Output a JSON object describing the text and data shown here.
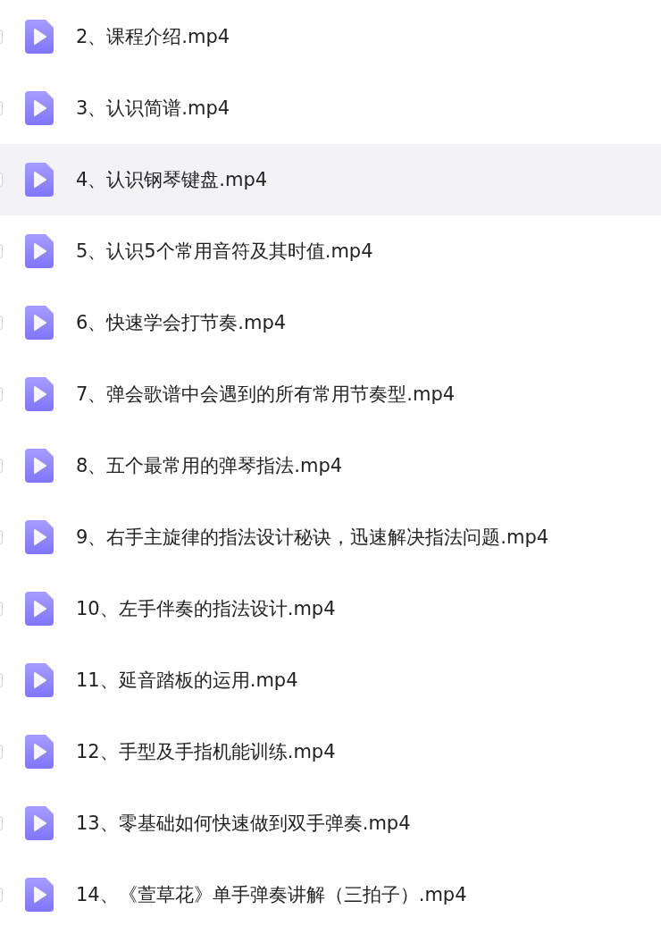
{
  "files": [
    {
      "name": "2、课程介绍.mp4",
      "checked": false,
      "selected": false
    },
    {
      "name": "3、认识简谱.mp4",
      "checked": false,
      "selected": false
    },
    {
      "name": "4、认识钢琴键盘.mp4",
      "checked": false,
      "selected": true
    },
    {
      "name": "5、认识5个常用音符及其时值.mp4",
      "checked": false,
      "selected": false
    },
    {
      "name": "6、快速学会打节奏.mp4",
      "checked": false,
      "selected": false
    },
    {
      "name": "7、弹会歌谱中会遇到的所有常用节奏型.mp4",
      "checked": false,
      "selected": false
    },
    {
      "name": "8、五个最常用的弹琴指法.mp4",
      "checked": false,
      "selected": false
    },
    {
      "name": "9、右手主旋律的指法设计秘诀，迅速解决指法问题.mp4",
      "checked": false,
      "selected": false
    },
    {
      "name": "10、左手伴奏的指法设计.mp4",
      "checked": false,
      "selected": false
    },
    {
      "name": "11、延音踏板的运用.mp4",
      "checked": false,
      "selected": false
    },
    {
      "name": "12、手型及手指机能训练.mp4",
      "checked": false,
      "selected": false
    },
    {
      "name": "13、零基础如何快速做到双手弹奏.mp4",
      "checked": false,
      "selected": false
    },
    {
      "name": "14、《萱草花》单手弹奏讲解（三拍子）.mp4",
      "checked": false,
      "selected": false
    }
  ]
}
